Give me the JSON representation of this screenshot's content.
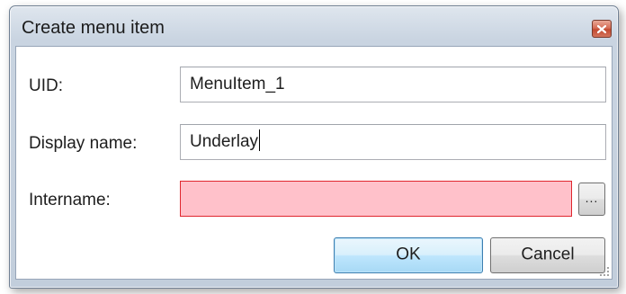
{
  "window": {
    "title": "Create menu item"
  },
  "icons": {
    "close": "close-icon",
    "resize": "resize-grip-icon"
  },
  "colors": {
    "error_fill": "#ffc1ca",
    "error_border": "#e0262e",
    "default_button_border": "#3c7fb1"
  },
  "form": {
    "uid": {
      "label": "UID:",
      "value": "MenuItem_1"
    },
    "display_name": {
      "label": "Display name:",
      "value": "Underlay"
    },
    "intername": {
      "label": "Intername:",
      "value": "",
      "browse_label": "..."
    }
  },
  "buttons": {
    "ok": "OK",
    "cancel": "Cancel"
  }
}
